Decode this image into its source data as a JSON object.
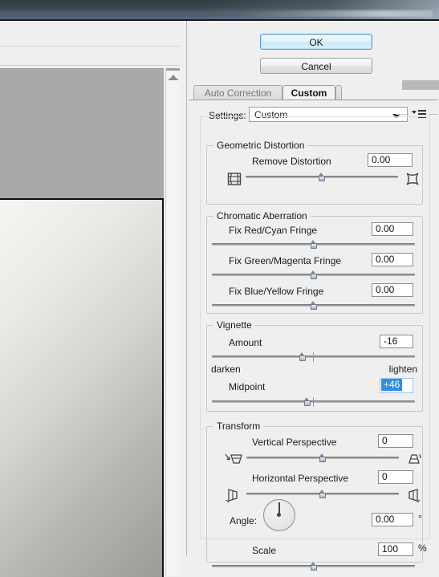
{
  "window": {
    "title_band": "photoshop-title-bar"
  },
  "preview": {
    "scroll_up_icon": "scroll-up-arrow-icon"
  },
  "dialog": {
    "buttons": {
      "ok": "OK",
      "cancel": "Cancel"
    },
    "tabs": [
      {
        "label": "Auto Correction",
        "active": false
      },
      {
        "label": "Custom",
        "active": true
      }
    ],
    "settings": {
      "label": "Settings:",
      "value": "Custom",
      "chevron_icon": "chevron-down-icon",
      "panel_menu_icon": "panel-menu-icon"
    },
    "groups": {
      "geometric_distortion": {
        "title": "Geometric Distortion",
        "rows": [
          {
            "label": "Remove Distortion",
            "value": "0.00",
            "slider_percent": 50,
            "left_icon": "barrel-distortion-icon",
            "right_icon": "pincushion-distortion-icon"
          }
        ]
      },
      "chromatic_aberration": {
        "title": "Chromatic Aberration",
        "rows": [
          {
            "label": "Fix Red/Cyan Fringe",
            "value": "0.00",
            "slider_percent": 50
          },
          {
            "label": "Fix Green/Magenta Fringe",
            "value": "0.00",
            "slider_percent": 50
          },
          {
            "label": "Fix Blue/Yellow Fringe",
            "value": "0.00",
            "slider_percent": 50
          }
        ]
      },
      "vignette": {
        "title": "Vignette",
        "rows": [
          {
            "label": "Amount",
            "value": "-16",
            "slider_percent": 45,
            "focused": false
          },
          {
            "label": "Midpoint",
            "value": "+46",
            "slider_percent": 47,
            "focused": true
          }
        ],
        "hint_left": "darken",
        "hint_right": "lighten"
      },
      "transform": {
        "title": "Transform",
        "rows": [
          {
            "label": "Vertical Perspective",
            "value": "0",
            "slider_percent": 50,
            "left_icon": "vertical-perspective-top-icon",
            "right_icon": "vertical-perspective-bottom-icon"
          },
          {
            "label": "Horizontal Perspective",
            "value": "0",
            "slider_percent": 50,
            "left_icon": "horizontal-perspective-left-icon",
            "right_icon": "horizontal-perspective-right-icon"
          }
        ],
        "angle": {
          "label": "Angle:",
          "value": "0.00",
          "unit": "°",
          "dial_icon": "angle-dial"
        },
        "scale": {
          "label": "Scale",
          "value": "100",
          "unit": "%",
          "slider_percent": 50
        }
      }
    }
  },
  "colors": {
    "accent_blue": "#2f8fe0",
    "ok_border": "#4fa3d8",
    "panel_bg": "#efefef",
    "titlebar_dark": "#2f3942"
  }
}
